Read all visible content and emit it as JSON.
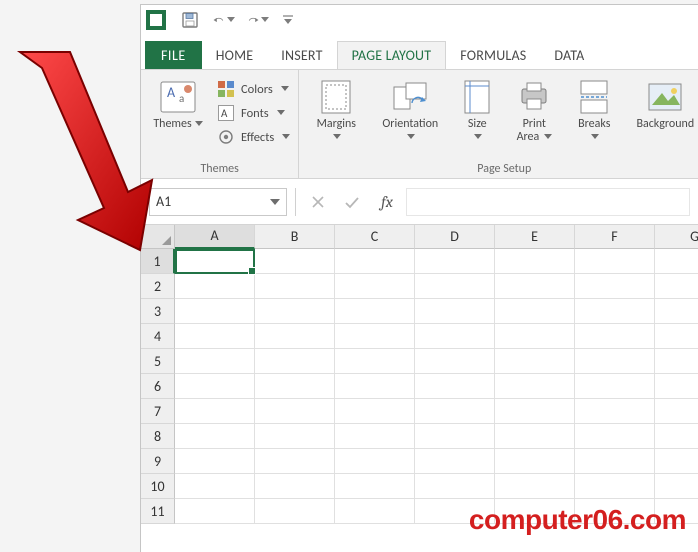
{
  "qat": {
    "undo_label": "Undo",
    "redo_label": "Redo",
    "save_label": "Save"
  },
  "tabs": {
    "file": "FILE",
    "home": "HOME",
    "insert": "INSERT",
    "page_layout": "PAGE LAYOUT",
    "formulas": "FORMULAS",
    "data": "DATA",
    "active": "page_layout"
  },
  "ribbon": {
    "themes_group_label": "Themes",
    "themes_btn": "Themes",
    "colors_btn": "Colors",
    "fonts_btn": "Fonts",
    "effects_btn": "Effects",
    "page_setup_group_label": "Page Setup",
    "margins_btn": "Margins",
    "orientation_btn": "Orientation",
    "size_btn": "Size",
    "print_area_btn_line1": "Print",
    "print_area_btn_line2": "Area",
    "breaks_btn": "Breaks",
    "background_btn": "Background"
  },
  "formula_bar": {
    "name_box_value": "A1",
    "fx_label": "fx",
    "formula_value": ""
  },
  "grid": {
    "columns": [
      "A",
      "B",
      "C",
      "D",
      "E",
      "F",
      "G"
    ],
    "rows": [
      "1",
      "2",
      "3",
      "4",
      "5",
      "6",
      "7",
      "8",
      "9",
      "10",
      "11"
    ],
    "active_cell": "A1"
  },
  "watermark": "computer06.com",
  "colors": {
    "brand_green": "#217346",
    "arrow_red": "#d41f1f"
  }
}
